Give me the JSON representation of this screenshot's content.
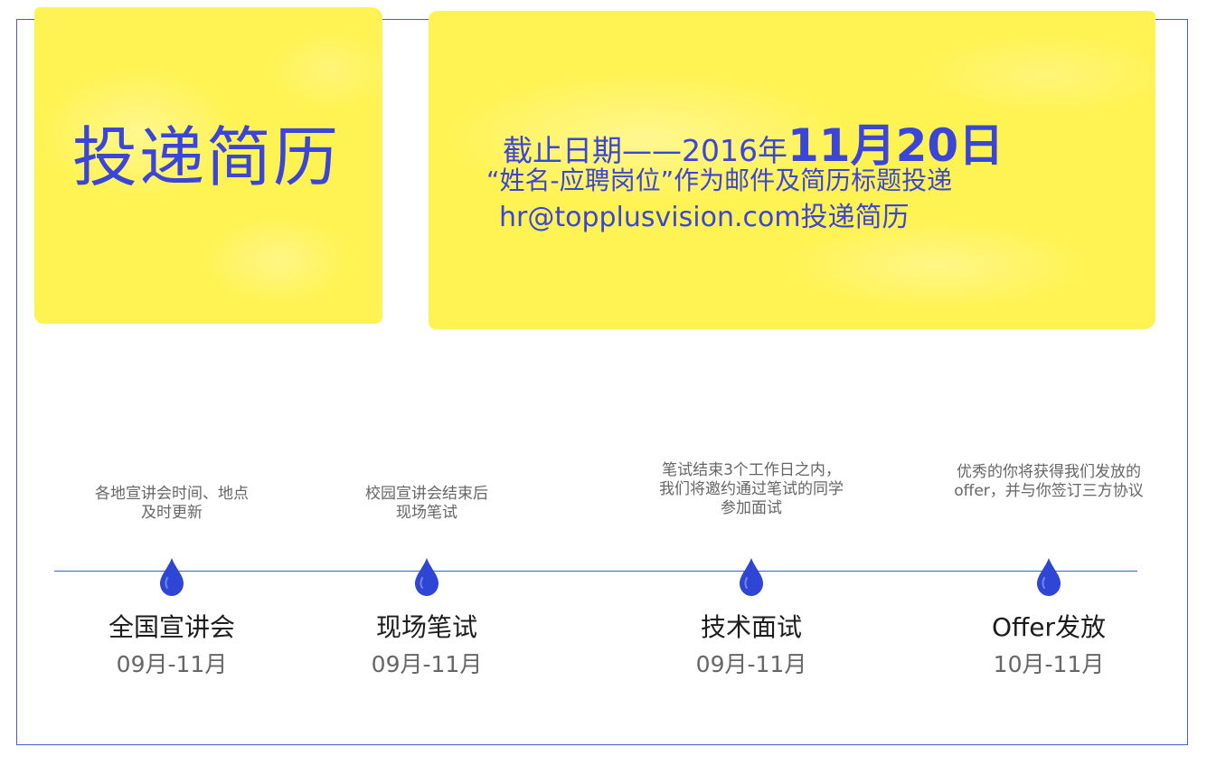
{
  "left_panel": {
    "title": "投递简历"
  },
  "right_panel": {
    "deadline_prefix": "截止日期——2016年",
    "deadline_date": "11月20日",
    "subject_rule": "“姓名-应聘岗位”作为邮件及简历标题投递",
    "email_line": "hr@topplusvision.com投递简历"
  },
  "timeline": {
    "steps": [
      {
        "desc": "各地宣讲会时间、地点\n及时更新",
        "title": "全国宣讲会",
        "dates": "09月-11月"
      },
      {
        "desc": "校园宣讲会结束后\n现场笔试",
        "title": "现场笔试",
        "dates": "09月-11月"
      },
      {
        "desc": "笔试结束3个工作日之内，\n我们将邀约通过笔试的同学\n参加面试",
        "title": "技术面试",
        "dates": "09月-11月"
      },
      {
        "desc": "优秀的你将获得我们发放的\noffer，并与你签订三方协议",
        "title": "Offer发放",
        "dates": "10月-11月"
      }
    ]
  },
  "colors": {
    "accent_blue": "#3b46d8",
    "highlight_yellow": "#fff353",
    "frame_blue": "#3f5fd0",
    "drop_blue": "#2e45d6"
  },
  "icons": {
    "timeline_marker": "water-drop-icon"
  }
}
